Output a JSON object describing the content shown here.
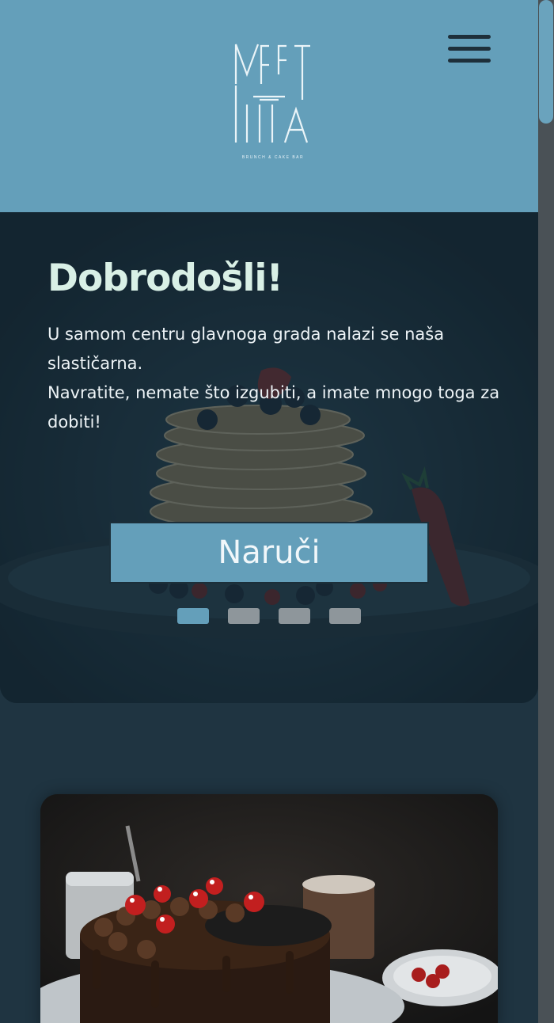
{
  "header": {
    "logo_word_top": "MEET",
    "logo_word_bottom": "MELIA",
    "logo_tagline": "BRUNCH & CAKE BAR",
    "menu_icon": "hamburger-menu-icon"
  },
  "hero": {
    "title": "Dobrodošli!",
    "paragraph_1": "U samom centru glavnoga grada nalazi se naša slastičarna.",
    "paragraph_2": "Navratite, nemate što izgubiti, a imate mnogo toga za dobiti!",
    "order_button_label": "Naruči",
    "background_image": "pancake-stack-with-berries",
    "slides_total": 4,
    "active_slide": 1
  },
  "featured_card": {
    "image": "chocolate-cake-with-cherries"
  },
  "colors": {
    "header_bg": "#649fba",
    "page_bg": "#1f3441",
    "title_color": "#d9f0e6",
    "button_bg": "#649fba",
    "dot_inactive": "#8e969b"
  }
}
